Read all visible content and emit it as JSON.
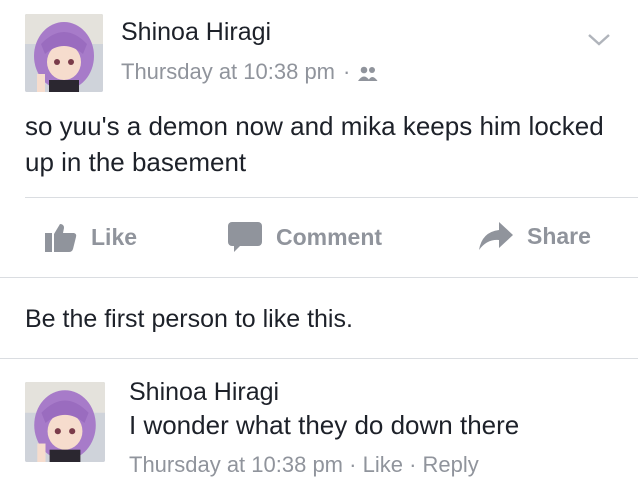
{
  "post": {
    "author": "Shinoa Hiragi",
    "timestamp": "Thursday at 10:38 pm",
    "separator": "·",
    "audience_icon": "friends-icon",
    "text": "so yuu's a demon now and mika keeps him locked up in the basement"
  },
  "actions": {
    "like_label": "Like",
    "comment_label": "Comment",
    "share_label": "Share"
  },
  "reactions": {
    "summary": "Be the first person to like this."
  },
  "comment": {
    "author": "Shinoa Hiragi",
    "text": "I wonder what they do down there",
    "timestamp": "Thursday at 10:38 pm",
    "separator_1": "·",
    "like_label": "Like",
    "separator_2": "·",
    "reply_label": "Reply"
  },
  "colors": {
    "text_primary": "#1d2129",
    "text_secondary": "#90949c",
    "divider": "#dadde1"
  }
}
